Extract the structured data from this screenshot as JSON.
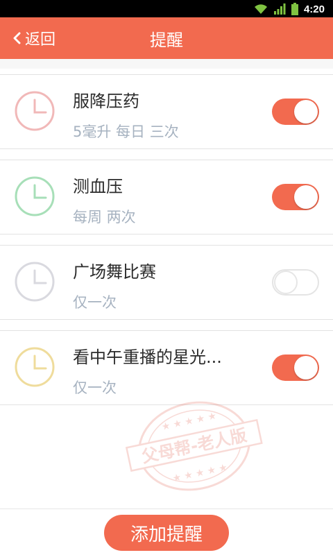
{
  "status_bar": {
    "time": "4:20"
  },
  "nav": {
    "back_label": "返回",
    "title": "提醒"
  },
  "reminders": [
    {
      "title": "服降压药",
      "subtitle": "5毫升 每日 三次",
      "enabled": true,
      "clock_color": "#f1b8b8"
    },
    {
      "title": "测血压",
      "subtitle": "每周 两次",
      "enabled": true,
      "clock_color": "#a7dfb8"
    },
    {
      "title": "广场舞比赛",
      "subtitle": "仅一次",
      "enabled": false,
      "clock_color": "#d9d9df"
    },
    {
      "title": "看中午重播的星光...",
      "subtitle": "仅一次",
      "enabled": true,
      "clock_color": "#efdc9c"
    }
  ],
  "watermark_text": "父母帮-老人版",
  "add_button_label": "添加提醒",
  "colors": {
    "accent": "#f26a4f",
    "subtitle": "#a6b2c0"
  }
}
